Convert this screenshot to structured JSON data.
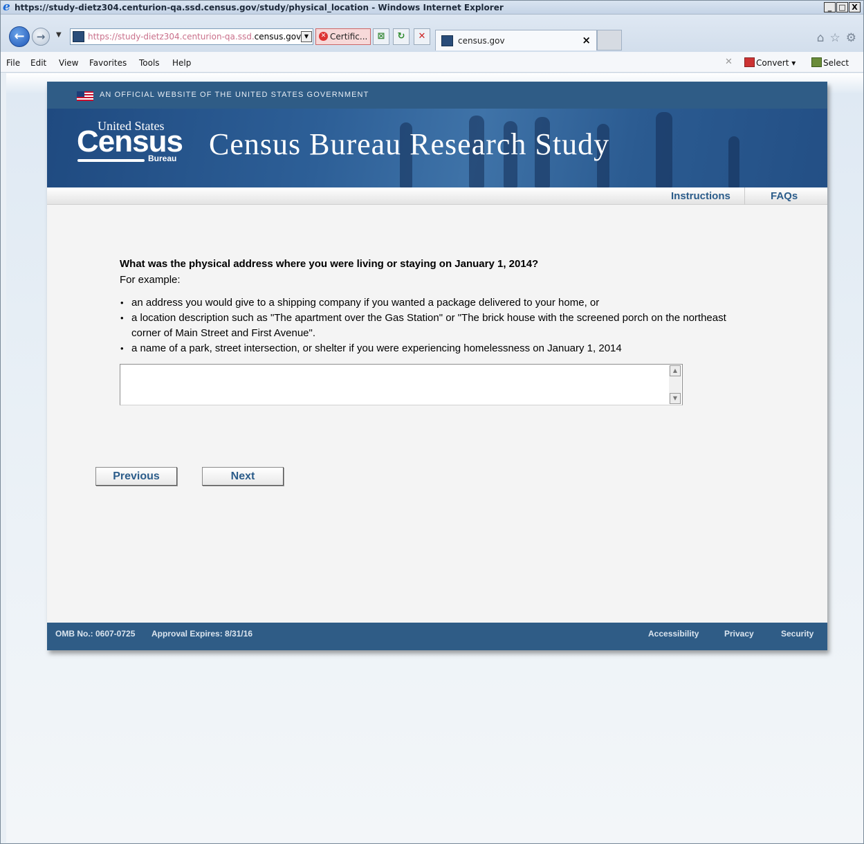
{
  "window": {
    "title": "https://study-dietz304.centurion-qa.ssd.census.gov/study/physical_location - Windows Internet Explorer",
    "buttons": [
      "_",
      "□",
      "X"
    ]
  },
  "address_bar": {
    "url_dim": "https://study-dietz304.centurion-qa.ssd.",
    "url_domain": "census.gov",
    "certificate": "Certific...",
    "tab_title": "census.gov",
    "tab_close": "×"
  },
  "menu": {
    "file": "File",
    "edit": "Edit",
    "view": "View",
    "favorites": "Favorites",
    "tools": "Tools",
    "help": "Help",
    "convert": "Convert",
    "select": "Select"
  },
  "header": {
    "gov_banner": "AN OFFICIAL WEBSITE OF THE UNITED STATES GOVERNMENT",
    "logo_top": "United States",
    "logo_main": "Census",
    "logo_bottom": "Bureau",
    "site_title": "Census Bureau Research Study"
  },
  "subnav": {
    "instructions": "Instructions",
    "faqs": "FAQs"
  },
  "question": {
    "text": "What was the physical address where you were living or staying on January 1, 2014?",
    "intro": "For example:",
    "bullets": [
      "an address you would give to a shipping company if you wanted a package delivered to your home, or",
      "a location description such as \"The apartment over the Gas Station\" or \"The brick house with the screened porch on the northeast corner of Main Street and First Avenue\".",
      "a name of a park, street intersection, or shelter if you were experiencing homelessness on January 1, 2014"
    ],
    "answer_value": ""
  },
  "buttons": {
    "previous": "Previous",
    "next": "Next"
  },
  "footer": {
    "omb": "OMB No.: 0607-0725",
    "expires": "Approval Expires: 8/31/16",
    "accessibility": "Accessibility",
    "privacy": "Privacy",
    "security": "Security"
  }
}
